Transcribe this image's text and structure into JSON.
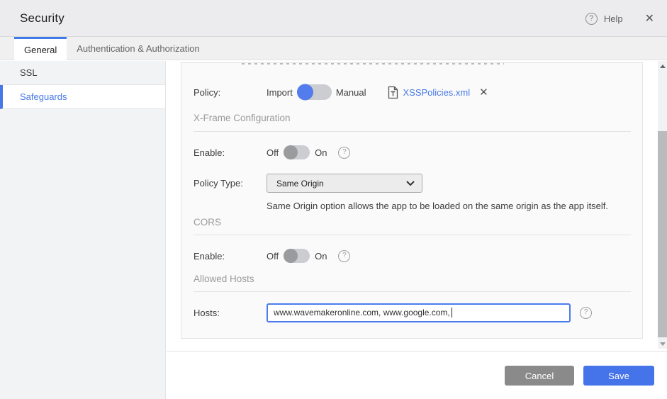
{
  "header": {
    "title": "Security",
    "help_label": "Help"
  },
  "icons": {
    "question": "?",
    "close": "✕",
    "remove": "✕"
  },
  "tabs": [
    {
      "label": "General"
    },
    {
      "label": "Authentication & Authorization"
    }
  ],
  "sidebar": {
    "items": [
      {
        "label": "SSL"
      },
      {
        "label": "Safeguards"
      }
    ]
  },
  "panel": {
    "policy": {
      "label": "Policy:",
      "option_left": "Import",
      "option_right": "Manual",
      "selected": "Import",
      "file_name": "XSSPolicies.xml"
    },
    "xframe": {
      "title": "X-Frame Configuration",
      "enable_label": "Enable:",
      "off_label": "Off",
      "on_label": "On",
      "enable_state": "Off",
      "policy_type_label": "Policy Type:",
      "policy_type_value": "Same Origin",
      "description": "Same Origin option allows the app to be loaded on the same origin as the app itself."
    },
    "cors": {
      "title": "CORS",
      "enable_label": "Enable:",
      "off_label": "Off",
      "on_label": "On",
      "enable_state": "Off"
    },
    "allowed_hosts": {
      "title": "Allowed Hosts",
      "hosts_label": "Hosts:",
      "hosts_value": "www.wavemakeronline.com, www.google.com, "
    }
  },
  "footer": {
    "cancel_label": "Cancel",
    "save_label": "Save"
  },
  "colors": {
    "accent_blue": "#4678e8",
    "toggle_on_knob": "#537cec",
    "toggle_off_knob": "#9a9b9d",
    "save_button": "#4573e9",
    "cancel_button": "#8a8a8a"
  }
}
